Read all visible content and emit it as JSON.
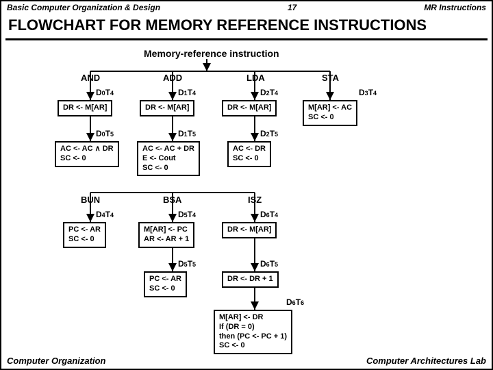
{
  "header": {
    "left": "Basic Computer Organization & Design",
    "page": "17",
    "right": "MR Instructions"
  },
  "title": "FLOWCHART FOR MEMORY REFERENCE INSTRUCTIONS",
  "root": "Memory-reference instruction",
  "col": {
    "and": "AND",
    "add": "ADD",
    "lda": "LDA",
    "sta": "STA",
    "bun": "BUN",
    "bsa": "BSA",
    "isz": "ISZ"
  },
  "d": {
    "d0t4": "D",
    "d0t4s": "0",
    "d0t4e": "T",
    "d0t4es": "4",
    "d1t4": "D",
    "d1t4s": "1",
    "d1t4e": "T",
    "d1t4es": "4",
    "d2t4": "D",
    "d2t4s": "2",
    "d2t4e": "T",
    "d2t4es": "4",
    "d3t4": "D",
    "d3t4s": "3",
    "d3t4e": "T",
    "d3t4es": "4",
    "d0t5": "D",
    "d0t5s": "0",
    "d0t5e": "T",
    "d0t5es": "5",
    "d1t5": "D",
    "d1t5s": "1",
    "d1t5e": "T",
    "d1t5es": "5",
    "d2t5": "D",
    "d2t5s": "2",
    "d2t5e": "T",
    "d2t5es": "5",
    "d4t4": "D",
    "d4t4s": "4",
    "d4t4e": "T",
    "d4t4es": "4",
    "d5t4": "D",
    "d5t4s": "5",
    "d5t4e": "T",
    "d5t4es": "4",
    "d6t4": "D",
    "d6t4s": "6",
    "d6t4e": "T",
    "d6t4es": "4",
    "d5t5": "D",
    "d5t5s": "5",
    "d5t5e": "T",
    "d5t5es": "5",
    "d6t5": "D",
    "d6t5s": "6",
    "d6t5e": "T",
    "d6t5es": "5",
    "d6t6": "D",
    "d6t6s": "6",
    "d6t6e": "T",
    "d6t6es": "6"
  },
  "box": {
    "b1": "DR <- M[AR]",
    "b2": "DR <- M[AR]",
    "b3": "DR <- M[AR]",
    "b4l1": "M[AR] <- AC",
    "b4l2": "SC <- 0",
    "b5l1": "AC <- AC ∧ DR",
    "b5l2": "SC <- 0",
    "b6l1": "AC <- AC + DR",
    "b6l2": "E <- Cout",
    "b6l3": "SC <- 0",
    "b7l1": "AC <- DR",
    "b7l2": "SC <- 0",
    "b8l1": "PC <- AR",
    "b8l2": "SC <- 0",
    "b9l1": "M[AR] <- PC",
    "b9l2": "AR <- AR + 1",
    "b10": "DR <- M[AR]",
    "b11l1": "PC <- AR",
    "b11l2": "SC <- 0",
    "b12": "DR <- DR + 1",
    "b13l1": "M[AR] <- DR",
    "b13l2": "If (DR = 0)",
    "b13l3": "then (PC <- PC + 1)",
    "b13l4": "SC <- 0"
  },
  "footer": {
    "left": "Computer Organization",
    "right": "Computer Architectures Lab"
  }
}
